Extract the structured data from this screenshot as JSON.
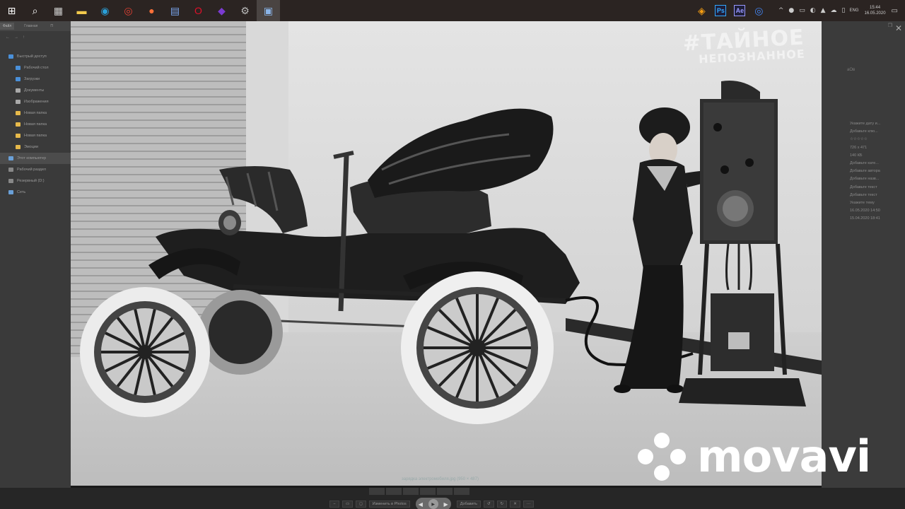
{
  "taskbar": {
    "apps": [
      {
        "name": "windows-start",
        "icon": "windows-icon",
        "color": "#ffffff"
      },
      {
        "name": "search",
        "icon": "search-icon",
        "color": "#ffffff"
      },
      {
        "name": "calculator",
        "icon": "calculator-icon",
        "color": "#cfcfcf"
      },
      {
        "name": "file-explorer",
        "icon": "folder-icon",
        "color": "#f2c94c"
      },
      {
        "name": "edge",
        "icon": "edge-icon",
        "color": "#2a9fd8"
      },
      {
        "name": "chrome",
        "icon": "chrome-icon",
        "color": "#e34133"
      },
      {
        "name": "firefox",
        "icon": "firefox-icon",
        "color": "#ff7139"
      },
      {
        "name": "document",
        "icon": "document-icon",
        "color": "#7aa7f0"
      },
      {
        "name": "opera",
        "icon": "opera-icon",
        "color": "#e0102a"
      },
      {
        "name": "media",
        "icon": "media-icon",
        "color": "#7b3bd1"
      },
      {
        "name": "settings",
        "icon": "gear-icon",
        "color": "#bbbbbb"
      },
      {
        "name": "photos",
        "icon": "photos-icon",
        "color": "#8ab4e8",
        "active": true
      }
    ],
    "pinned_right": [
      {
        "name": "paint-app",
        "icon": "paint-icon",
        "color": "#f39c12"
      },
      {
        "name": "photoshop",
        "label": "Ps",
        "color": "#31a8ff"
      },
      {
        "name": "after-effects",
        "label": "Ae",
        "color": "#9999ff"
      },
      {
        "name": "chrome-alt",
        "icon": "chrome-icon",
        "color": "#4285f4"
      }
    ],
    "tray": [
      "^",
      "●",
      "▭",
      "◐",
      "▲",
      "☁",
      "▯"
    ],
    "lang": "ENG",
    "time": "15:44",
    "date": "16.05.2020",
    "notification_icon": "▭"
  },
  "explorer": {
    "tabs": [
      "Файл",
      "Главная",
      "П"
    ],
    "nav": [
      "←",
      "→",
      "↑"
    ],
    "items": [
      {
        "label": "Быстрый доступ",
        "color": "#4a90d9",
        "sub": false
      },
      {
        "label": "Рабочий стол",
        "color": "#4a90d9",
        "sub": true
      },
      {
        "label": "Загрузки",
        "color": "#4a90d9",
        "sub": true
      },
      {
        "label": "Документы",
        "color": "#aaaaaa",
        "sub": true
      },
      {
        "label": "Изображения",
        "color": "#aaaaaa",
        "sub": true
      },
      {
        "label": "Новая папка",
        "color": "#e6b94a",
        "sub": true
      },
      {
        "label": "Новая папка",
        "color": "#e6b94a",
        "sub": true
      },
      {
        "label": "Новая папка",
        "color": "#e6b94a",
        "sub": true
      },
      {
        "label": "Эмоции",
        "color": "#e6b94a",
        "sub": true
      },
      {
        "label": "Этот компьютер",
        "color": "#6aa0d8",
        "sub": false,
        "highlight": true
      },
      {
        "label": "Рабочий раздел",
        "color": "#888888",
        "sub": false
      },
      {
        "label": "Резервный (D:)",
        "color": "#888888",
        "sub": false
      },
      {
        "label": "Сеть",
        "color": "#6aa0d8",
        "sub": false
      }
    ]
  },
  "details": {
    "rows": [
      "Укажите дату и...",
      "Добавьте клю...",
      "☆☆☆☆☆",
      "726 x 471",
      "140 КБ",
      "Добавьте кате...",
      "Добавьте автора",
      "Добавьте назв...",
      "Добавьте текст",
      "Добавьте текст",
      "Укажите тему",
      "16.05.2020 14:50",
      "15.04.2020 18:41"
    ],
    "misc": "аОв"
  },
  "photo": {
    "watermark_line1": "#ТАЙНОЕ",
    "watermark_line2": "НЕПОЗНАННОЕ",
    "caption": "зарядка электромобиля.jpg (950 × 487)"
  },
  "viewer": {
    "edit_label": "Изменить в Photos",
    "add_label": "Добавить"
  },
  "brand": {
    "logo_text": "movavi"
  }
}
